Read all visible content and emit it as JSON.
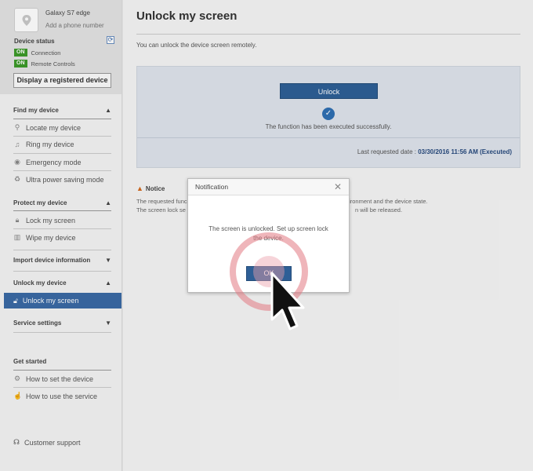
{
  "device": {
    "name": "Galaxy S7 edge",
    "add_phone": "Add a phone number",
    "status_title": "Device status",
    "status": [
      {
        "badge": "ON",
        "label": "Connection"
      },
      {
        "badge": "ON",
        "label": "Remote Controls"
      }
    ],
    "display_button": "Display a registered device"
  },
  "sidebar": {
    "find": {
      "title": "Find my device",
      "items": [
        {
          "label": "Locate my device",
          "icon": "search-icon"
        },
        {
          "label": "Ring my device",
          "icon": "music-note-icon"
        },
        {
          "label": "Emergency mode",
          "icon": "emergency-icon"
        },
        {
          "label": "Ultra power saving mode",
          "icon": "recycle-icon"
        }
      ]
    },
    "protect": {
      "title": "Protect my device",
      "items": [
        {
          "label": "Lock my screen",
          "icon": "lock-icon"
        },
        {
          "label": "Wipe my device",
          "icon": "trash-icon"
        }
      ]
    },
    "import_title": "Import device information",
    "unlock": {
      "title": "Unlock my device",
      "active_item": "Unlock my screen"
    },
    "service_title": "Service settings",
    "get_started": {
      "title": "Get started",
      "items": [
        {
          "label": "How to set the device",
          "icon": "gear-icon"
        },
        {
          "label": "How to use the service",
          "icon": "hand-pointer-icon"
        }
      ]
    },
    "support": "Customer support"
  },
  "main": {
    "title": "Unlock my screen",
    "intro": "You can unlock the device screen remotely.",
    "unlock_button": "Unlock",
    "success_text": "The function has been executed successfully.",
    "last_requested_label": "Last requested date :",
    "last_requested_value": "03/30/2016 11:56 AM (Executed)",
    "notice_title": "Notice",
    "notice_lines": [
      "The requested func",
      "environment and the device state.",
      "The screen lock se",
      "n will be released."
    ]
  },
  "dialog": {
    "title": "Notification",
    "message_line1": "The screen is unlocked. Set up screen lock",
    "message_line2": "the device.",
    "ok": "OK"
  }
}
